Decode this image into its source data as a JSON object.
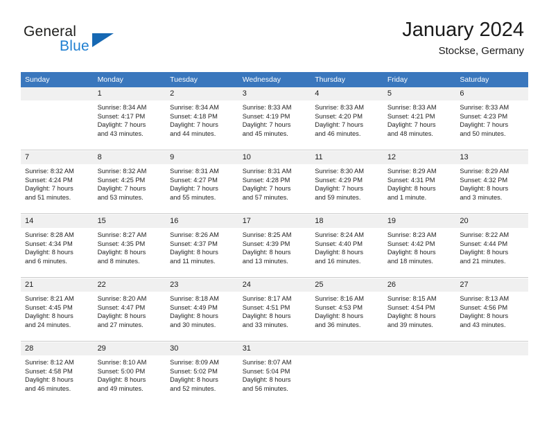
{
  "logo": {
    "word1": "General",
    "word2": "Blue",
    "triangle_color": "#1668b3",
    "blue_color": "#1f7fd1"
  },
  "header": {
    "title": "January 2024",
    "subtitle": "Stockse, Germany",
    "header_bg": "#3a77bd",
    "daynum_bg": "#f0f0f0"
  },
  "weekday_headers": [
    "Sunday",
    "Monday",
    "Tuesday",
    "Wednesday",
    "Thursday",
    "Friday",
    "Saturday"
  ],
  "weeks": [
    [
      {
        "day": "",
        "blank": true
      },
      {
        "day": "1",
        "sunrise": "Sunrise: 8:34 AM",
        "sunset": "Sunset: 4:17 PM",
        "daylight1": "Daylight: 7 hours",
        "daylight2": "and 43 minutes."
      },
      {
        "day": "2",
        "sunrise": "Sunrise: 8:34 AM",
        "sunset": "Sunset: 4:18 PM",
        "daylight1": "Daylight: 7 hours",
        "daylight2": "and 44 minutes."
      },
      {
        "day": "3",
        "sunrise": "Sunrise: 8:33 AM",
        "sunset": "Sunset: 4:19 PM",
        "daylight1": "Daylight: 7 hours",
        "daylight2": "and 45 minutes."
      },
      {
        "day": "4",
        "sunrise": "Sunrise: 8:33 AM",
        "sunset": "Sunset: 4:20 PM",
        "daylight1": "Daylight: 7 hours",
        "daylight2": "and 46 minutes."
      },
      {
        "day": "5",
        "sunrise": "Sunrise: 8:33 AM",
        "sunset": "Sunset: 4:21 PM",
        "daylight1": "Daylight: 7 hours",
        "daylight2": "and 48 minutes."
      },
      {
        "day": "6",
        "sunrise": "Sunrise: 8:33 AM",
        "sunset": "Sunset: 4:23 PM",
        "daylight1": "Daylight: 7 hours",
        "daylight2": "and 50 minutes."
      }
    ],
    [
      {
        "day": "7",
        "sunrise": "Sunrise: 8:32 AM",
        "sunset": "Sunset: 4:24 PM",
        "daylight1": "Daylight: 7 hours",
        "daylight2": "and 51 minutes."
      },
      {
        "day": "8",
        "sunrise": "Sunrise: 8:32 AM",
        "sunset": "Sunset: 4:25 PM",
        "daylight1": "Daylight: 7 hours",
        "daylight2": "and 53 minutes."
      },
      {
        "day": "9",
        "sunrise": "Sunrise: 8:31 AM",
        "sunset": "Sunset: 4:27 PM",
        "daylight1": "Daylight: 7 hours",
        "daylight2": "and 55 minutes."
      },
      {
        "day": "10",
        "sunrise": "Sunrise: 8:31 AM",
        "sunset": "Sunset: 4:28 PM",
        "daylight1": "Daylight: 7 hours",
        "daylight2": "and 57 minutes."
      },
      {
        "day": "11",
        "sunrise": "Sunrise: 8:30 AM",
        "sunset": "Sunset: 4:29 PM",
        "daylight1": "Daylight: 7 hours",
        "daylight2": "and 59 minutes."
      },
      {
        "day": "12",
        "sunrise": "Sunrise: 8:29 AM",
        "sunset": "Sunset: 4:31 PM",
        "daylight1": "Daylight: 8 hours",
        "daylight2": "and 1 minute."
      },
      {
        "day": "13",
        "sunrise": "Sunrise: 8:29 AM",
        "sunset": "Sunset: 4:32 PM",
        "daylight1": "Daylight: 8 hours",
        "daylight2": "and 3 minutes."
      }
    ],
    [
      {
        "day": "14",
        "sunrise": "Sunrise: 8:28 AM",
        "sunset": "Sunset: 4:34 PM",
        "daylight1": "Daylight: 8 hours",
        "daylight2": "and 6 minutes."
      },
      {
        "day": "15",
        "sunrise": "Sunrise: 8:27 AM",
        "sunset": "Sunset: 4:35 PM",
        "daylight1": "Daylight: 8 hours",
        "daylight2": "and 8 minutes."
      },
      {
        "day": "16",
        "sunrise": "Sunrise: 8:26 AM",
        "sunset": "Sunset: 4:37 PM",
        "daylight1": "Daylight: 8 hours",
        "daylight2": "and 11 minutes."
      },
      {
        "day": "17",
        "sunrise": "Sunrise: 8:25 AM",
        "sunset": "Sunset: 4:39 PM",
        "daylight1": "Daylight: 8 hours",
        "daylight2": "and 13 minutes."
      },
      {
        "day": "18",
        "sunrise": "Sunrise: 8:24 AM",
        "sunset": "Sunset: 4:40 PM",
        "daylight1": "Daylight: 8 hours",
        "daylight2": "and 16 minutes."
      },
      {
        "day": "19",
        "sunrise": "Sunrise: 8:23 AM",
        "sunset": "Sunset: 4:42 PM",
        "daylight1": "Daylight: 8 hours",
        "daylight2": "and 18 minutes."
      },
      {
        "day": "20",
        "sunrise": "Sunrise: 8:22 AM",
        "sunset": "Sunset: 4:44 PM",
        "daylight1": "Daylight: 8 hours",
        "daylight2": "and 21 minutes."
      }
    ],
    [
      {
        "day": "21",
        "sunrise": "Sunrise: 8:21 AM",
        "sunset": "Sunset: 4:45 PM",
        "daylight1": "Daylight: 8 hours",
        "daylight2": "and 24 minutes."
      },
      {
        "day": "22",
        "sunrise": "Sunrise: 8:20 AM",
        "sunset": "Sunset: 4:47 PM",
        "daylight1": "Daylight: 8 hours",
        "daylight2": "and 27 minutes."
      },
      {
        "day": "23",
        "sunrise": "Sunrise: 8:18 AM",
        "sunset": "Sunset: 4:49 PM",
        "daylight1": "Daylight: 8 hours",
        "daylight2": "and 30 minutes."
      },
      {
        "day": "24",
        "sunrise": "Sunrise: 8:17 AM",
        "sunset": "Sunset: 4:51 PM",
        "daylight1": "Daylight: 8 hours",
        "daylight2": "and 33 minutes."
      },
      {
        "day": "25",
        "sunrise": "Sunrise: 8:16 AM",
        "sunset": "Sunset: 4:53 PM",
        "daylight1": "Daylight: 8 hours",
        "daylight2": "and 36 minutes."
      },
      {
        "day": "26",
        "sunrise": "Sunrise: 8:15 AM",
        "sunset": "Sunset: 4:54 PM",
        "daylight1": "Daylight: 8 hours",
        "daylight2": "and 39 minutes."
      },
      {
        "day": "27",
        "sunrise": "Sunrise: 8:13 AM",
        "sunset": "Sunset: 4:56 PM",
        "daylight1": "Daylight: 8 hours",
        "daylight2": "and 43 minutes."
      }
    ],
    [
      {
        "day": "28",
        "sunrise": "Sunrise: 8:12 AM",
        "sunset": "Sunset: 4:58 PM",
        "daylight1": "Daylight: 8 hours",
        "daylight2": "and 46 minutes."
      },
      {
        "day": "29",
        "sunrise": "Sunrise: 8:10 AM",
        "sunset": "Sunset: 5:00 PM",
        "daylight1": "Daylight: 8 hours",
        "daylight2": "and 49 minutes."
      },
      {
        "day": "30",
        "sunrise": "Sunrise: 8:09 AM",
        "sunset": "Sunset: 5:02 PM",
        "daylight1": "Daylight: 8 hours",
        "daylight2": "and 52 minutes."
      },
      {
        "day": "31",
        "sunrise": "Sunrise: 8:07 AM",
        "sunset": "Sunset: 5:04 PM",
        "daylight1": "Daylight: 8 hours",
        "daylight2": "and 56 minutes."
      },
      {
        "day": "",
        "blank": true
      },
      {
        "day": "",
        "blank": true
      },
      {
        "day": "",
        "blank": true
      }
    ]
  ]
}
